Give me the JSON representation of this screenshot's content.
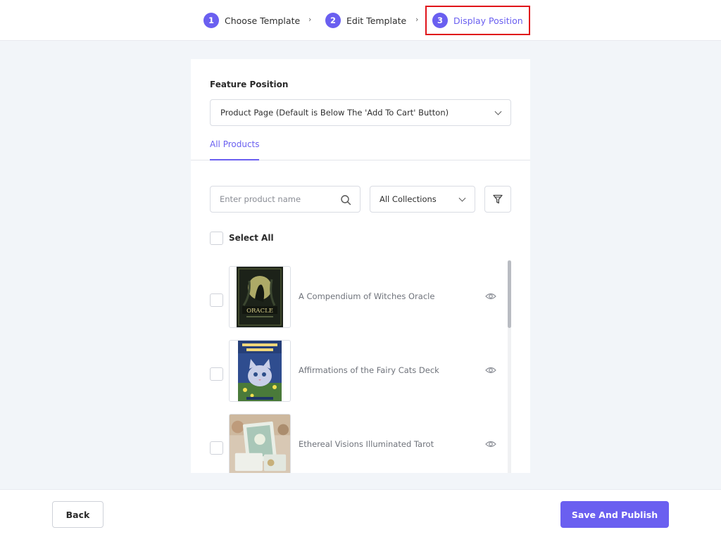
{
  "stepper": {
    "steps": [
      {
        "number": "1",
        "label": "Choose Template"
      },
      {
        "number": "2",
        "label": "Edit Template"
      },
      {
        "number": "3",
        "label": "Display Position"
      }
    ],
    "separator": "›",
    "active_step": 3,
    "highlight_color": "#e0141a"
  },
  "feature_position": {
    "label": "Feature Position",
    "selected": "Product Page (Default is Below The 'Add To Cart' Button)"
  },
  "tabs": [
    {
      "label": "All Products",
      "active": true
    }
  ],
  "search": {
    "placeholder": "Enter product name",
    "value": ""
  },
  "collections_filter": {
    "selected": "All Collections"
  },
  "select_all_label": "Select All",
  "products": [
    {
      "name": "A Compendium of Witches Oracle",
      "checked": false,
      "thumb_icon": "witches-oracle-cover"
    },
    {
      "name": "Affirmations of the Fairy Cats Deck",
      "checked": false,
      "thumb_icon": "fairy-cats-cover"
    },
    {
      "name": "Ethereal Visions Illuminated Tarot",
      "checked": false,
      "thumb_icon": "ethereal-visions-photo"
    }
  ],
  "footer": {
    "back_label": "Back",
    "save_label": "Save And Publish"
  },
  "colors": {
    "accent": "#6a5ff0",
    "background": "#f2f5f9"
  }
}
